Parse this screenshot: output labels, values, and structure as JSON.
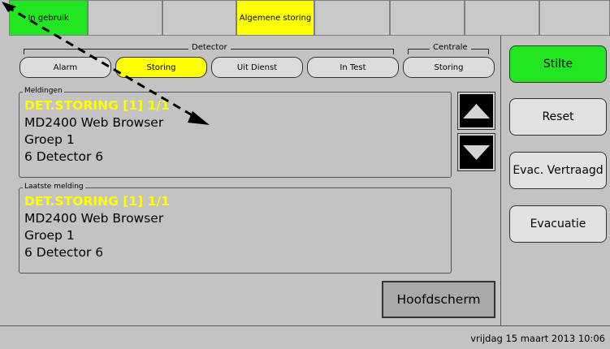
{
  "status_bar": [
    {
      "label": "In gebruik",
      "color": "#21e621"
    },
    {
      "label": "",
      "color": "#c9c9c9"
    },
    {
      "label": "",
      "color": "#c9c9c9"
    },
    {
      "label": "Algemene storing",
      "color": "#ffff00"
    },
    {
      "label": "",
      "color": "#c9c9c9"
    },
    {
      "label": "",
      "color": "#c9c9c9"
    },
    {
      "label": "",
      "color": "#c9c9c9"
    },
    {
      "label": "",
      "color": "#c9c9c9"
    }
  ],
  "groups": {
    "detector": "Detector",
    "centrale": "Centrale"
  },
  "filters": {
    "alarm": "Alarm",
    "storing": "Storing",
    "uit_dienst": "Uit Dienst",
    "in_test": "In Test",
    "centrale_storing": "Storing"
  },
  "meldingen": {
    "label": "Meldingen",
    "lines": [
      "DET.STORING [1] 1/1",
      "MD2400 Web Browser",
      "Groep 1",
      "6 Detector 6"
    ]
  },
  "laatste_melding": {
    "label": "Laatste melding",
    "lines": [
      "DET.STORING [1] 1/1",
      "MD2400 Web Browser",
      "Groep 1",
      "6 Detector 6"
    ]
  },
  "side_buttons": {
    "stilte": "Stilte",
    "reset": "Reset",
    "evac_vertraagd": "Evac. Vertraagd",
    "evacuatie": "Evacuatie"
  },
  "hoofdscherm": "Hoofdscherm",
  "datetime": "vrijdag 15 maart 2013 10:06",
  "colors": {
    "accent_green": "#21e621",
    "accent_yellow": "#ffff00",
    "background": "#c3c3c3"
  },
  "icons": {
    "scroll_up": "triangle-up-icon",
    "scroll_down": "triangle-down-icon",
    "cursor": "dashed-arrow-cursor-icon"
  }
}
